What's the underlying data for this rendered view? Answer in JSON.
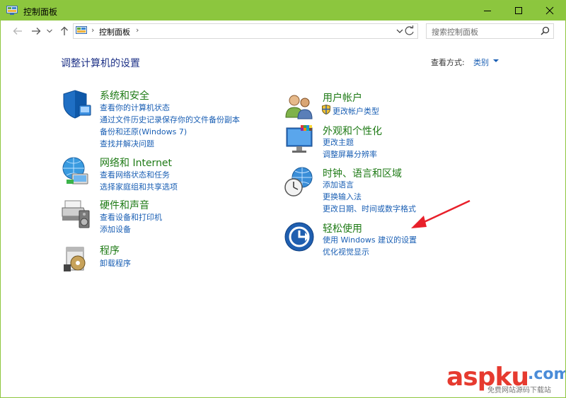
{
  "window": {
    "title": "控制面板"
  },
  "navigation": {
    "address_path": "控制面板",
    "search_placeholder": "搜索控制面板"
  },
  "main": {
    "heading": "调整计算机的设置",
    "view_by_label": "查看方式:",
    "view_by_value": "类别"
  },
  "categories_left": [
    {
      "title": "系统和安全",
      "links": [
        "查看你的计算机状态",
        "通过文件历史记录保存你的文件备份副本",
        "备份和还原(Windows 7)",
        "查找并解决问题"
      ]
    },
    {
      "title": "网络和 Internet",
      "links": [
        "查看网络状态和任务",
        "选择家庭组和共享选项"
      ]
    },
    {
      "title": "硬件和声音",
      "links": [
        "查看设备和打印机",
        "添加设备"
      ]
    },
    {
      "title": "程序",
      "links": [
        "卸载程序"
      ]
    }
  ],
  "categories_right": [
    {
      "title": "用户帐户",
      "links": [
        "更改帐户类型"
      ]
    },
    {
      "title": "外观和个性化",
      "links": [
        "更改主题",
        "调整屏幕分辨率"
      ]
    },
    {
      "title": "时钟、语言和区域",
      "links": [
        "添加语言",
        "更换输入法",
        "更改日期、时间或数字格式"
      ]
    },
    {
      "title": "轻松使用",
      "links": [
        "使用 Windows 建议的设置",
        "优化视觉显示"
      ]
    }
  ],
  "watermark": {
    "brand": "aspku",
    "suffix": ".com",
    "tagline": "免费网站源码下载站"
  },
  "colors": {
    "titlebar": "#8cc63e",
    "link": "#1a5fb4",
    "category_title": "#1e7a15",
    "heading": "#1e3287",
    "annotation_arrow": "#e8202a"
  }
}
